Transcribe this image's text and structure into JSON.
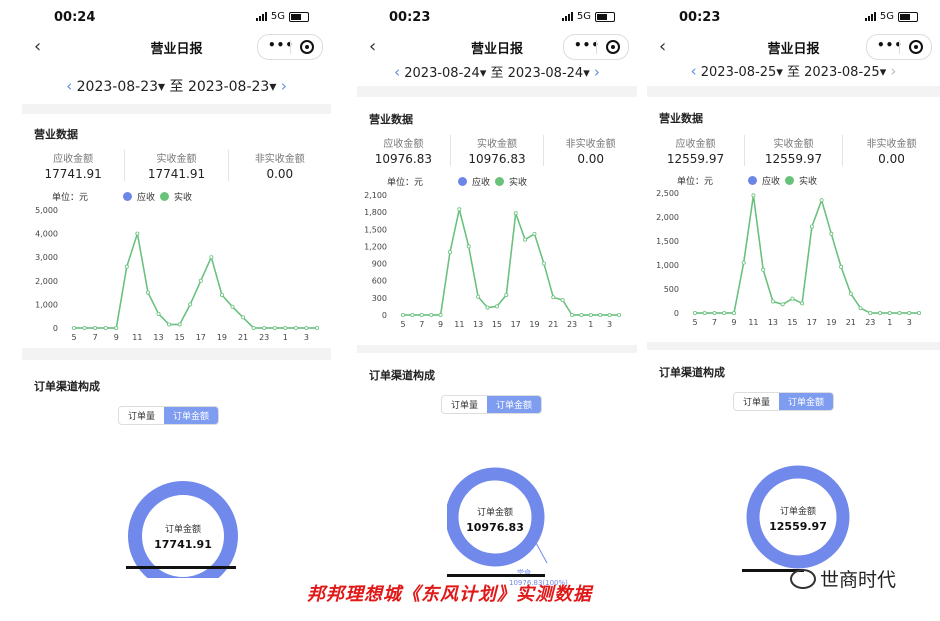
{
  "phones": [
    {
      "time": "00:24",
      "network": "5G",
      "title": "营业日报",
      "date_from": "2023-08-23",
      "date_sep": "至",
      "date_to": "2023-08-23",
      "section_business": "营业数据",
      "metrics": [
        {
          "label": "应收金额",
          "value": "17741.91"
        },
        {
          "label": "实收金额",
          "value": "17741.91"
        },
        {
          "label": "非实收金额",
          "value": "0.00"
        }
      ],
      "unit": "单位：元",
      "legend_receivable": "应收",
      "legend_received": "实收",
      "y_ticks": [
        "0",
        "1,000",
        "2,000",
        "3,000",
        "4,000",
        "5,000"
      ],
      "y_max": 5000,
      "section_channel": "订单渠道构成",
      "toggle_count": "订单量",
      "toggle_amount": "订单金额",
      "donut_label": "订单金额",
      "donut_value": "17741.91"
    },
    {
      "time": "00:23",
      "network": "5G",
      "title": "营业日报",
      "date_from": "2023-08-24",
      "date_sep": "至",
      "date_to": "2023-08-24",
      "section_business": "营业数据",
      "metrics": [
        {
          "label": "应收金额",
          "value": "10976.83"
        },
        {
          "label": "实收金额",
          "value": "10976.83"
        },
        {
          "label": "非实收金额",
          "value": "0.00"
        }
      ],
      "unit": "单位：元",
      "legend_receivable": "应收",
      "legend_received": "实收",
      "y_ticks": [
        "0",
        "300",
        "600",
        "900",
        "1,200",
        "1,500",
        "1,800",
        "2,100"
      ],
      "y_max": 2100,
      "section_channel": "订单渠道构成",
      "toggle_count": "订单量",
      "toggle_amount": "订单金额",
      "donut_label": "订单金额",
      "donut_value": "10976.83",
      "donut_callout_name": "堂食",
      "donut_callout_value": "10976.83(100%)"
    },
    {
      "time": "00:23",
      "network": "5G",
      "title": "营业日报",
      "date_from": "2023-08-25",
      "date_sep": "至",
      "date_to": "2023-08-25",
      "section_business": "营业数据",
      "metrics": [
        {
          "label": "应收金额",
          "value": "12559.97"
        },
        {
          "label": "实收金额",
          "value": "12559.97"
        },
        {
          "label": "非实收金额",
          "value": "0.00"
        }
      ],
      "unit": "单位：元",
      "legend_receivable": "应收",
      "legend_received": "实收",
      "y_ticks": [
        "0",
        "500",
        "1,000",
        "1,500",
        "2,000",
        "2,500"
      ],
      "y_max": 2500,
      "section_channel": "订单渠道构成",
      "toggle_count": "订单量",
      "toggle_amount": "订单金额",
      "donut_label": "订单金额",
      "donut_value": "12559.97"
    }
  ],
  "chart_data": [
    {
      "type": "line",
      "x": [
        5,
        6,
        7,
        8,
        9,
        10,
        11,
        12,
        13,
        14,
        15,
        16,
        17,
        18,
        19,
        20,
        21,
        22,
        23,
        24,
        1,
        2,
        3,
        4
      ],
      "x_tick_labels": [
        "5",
        "7",
        "9",
        "11",
        "13",
        "15",
        "17",
        "19",
        "21",
        "23",
        "1",
        "3"
      ],
      "series": [
        {
          "name": "应收",
          "values": [
            0,
            0,
            0,
            0,
            0,
            2600,
            4000,
            1500,
            600,
            150,
            150,
            1000,
            2000,
            3000,
            1400,
            900,
            450,
            0,
            0,
            0,
            0,
            0,
            0,
            0
          ]
        },
        {
          "name": "实收",
          "values": [
            0,
            0,
            0,
            0,
            0,
            2600,
            4000,
            1500,
            600,
            150,
            150,
            1000,
            2000,
            3000,
            1400,
            900,
            450,
            0,
            0,
            0,
            0,
            0,
            0,
            0
          ]
        }
      ],
      "ylim": [
        0,
        5000
      ]
    },
    {
      "type": "line",
      "x": [
        5,
        6,
        7,
        8,
        9,
        10,
        11,
        12,
        13,
        14,
        15,
        16,
        17,
        18,
        19,
        20,
        21,
        22,
        23,
        24,
        1,
        2,
        3,
        4
      ],
      "x_tick_labels": [
        "5",
        "7",
        "9",
        "11",
        "13",
        "15",
        "17",
        "19",
        "21",
        "23",
        "1",
        "3"
      ],
      "series": [
        {
          "name": "应收",
          "values": [
            0,
            0,
            0,
            0,
            0,
            1100,
            1850,
            1200,
            320,
            130,
            150,
            350,
            1780,
            1320,
            1420,
            900,
            310,
            260,
            0,
            0,
            0,
            0,
            0,
            0
          ]
        },
        {
          "name": "实收",
          "values": [
            0,
            0,
            0,
            0,
            0,
            1100,
            1850,
            1200,
            320,
            130,
            150,
            350,
            1780,
            1320,
            1420,
            900,
            310,
            260,
            0,
            0,
            0,
            0,
            0,
            0
          ]
        }
      ],
      "ylim": [
        0,
        2100
      ]
    },
    {
      "type": "line",
      "x": [
        5,
        6,
        7,
        8,
        9,
        10,
        11,
        12,
        13,
        14,
        15,
        16,
        17,
        18,
        19,
        20,
        21,
        22,
        23,
        24,
        1,
        2,
        3,
        4
      ],
      "x_tick_labels": [
        "5",
        "7",
        "9",
        "11",
        "13",
        "15",
        "17",
        "19",
        "21",
        "23",
        "1",
        "3"
      ],
      "series": [
        {
          "name": "应收",
          "values": [
            0,
            0,
            0,
            0,
            0,
            1050,
            2450,
            900,
            240,
            180,
            300,
            200,
            1800,
            2350,
            1650,
            960,
            400,
            100,
            0,
            0,
            0,
            0,
            0,
            0
          ]
        },
        {
          "name": "实收",
          "values": [
            0,
            0,
            0,
            0,
            0,
            1050,
            2450,
            900,
            240,
            180,
            300,
            200,
            1800,
            2350,
            1650,
            960,
            400,
            100,
            0,
            0,
            0,
            0,
            0,
            0
          ]
        }
      ],
      "ylim": [
        0,
        2500
      ]
    }
  ],
  "colors": {
    "receivable": "#6d85e6",
    "received": "#69c27a",
    "donut": "#7289ec",
    "accent": "#5b8fe0"
  },
  "caption": "邦邦理想城《东风计划》实测数据",
  "watermark": "世商时代"
}
